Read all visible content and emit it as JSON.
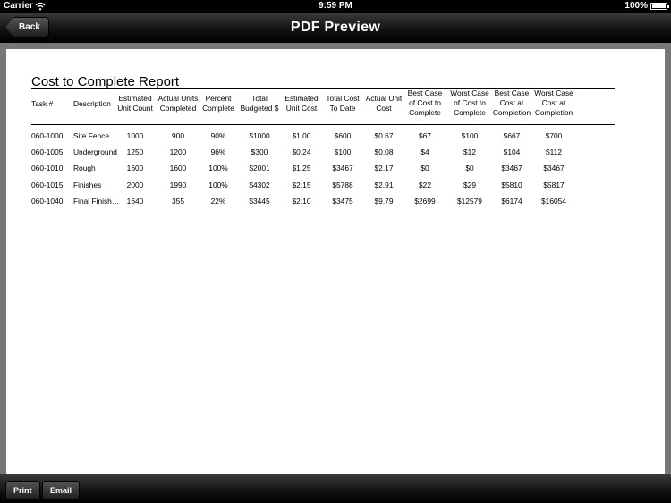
{
  "status": {
    "carrier": "Carrier",
    "time": "9:59 PM",
    "battery": "100%"
  },
  "nav": {
    "back_label": "Back",
    "title": "PDF Preview"
  },
  "report": {
    "title": "Cost to Complete Report",
    "columns": [
      "Task #",
      "Description",
      "Estimated Unit Count",
      "Actual Units Completed",
      "Percent Complete",
      "Total Budgeted $",
      "Estimated Unit Cost",
      "Total Cost To Date",
      "Actual Unit Cost",
      "Best Case of Cost to Complete",
      "Worst Case of Cost to Complete",
      "Best Case Cost at Completion",
      "Worst Case Cost at Completion"
    ],
    "rows": [
      [
        "060-1000",
        "Site Fence",
        "1000",
        "900",
        "90%",
        "$1000",
        "$1.00",
        "$600",
        "$0.67",
        "$67",
        "$100",
        "$667",
        "$700"
      ],
      [
        "060-1005",
        "Underground",
        "1250",
        "1200",
        "96%",
        "$300",
        "$0.24",
        "$100",
        "$0.08",
        "$4",
        "$12",
        "$104",
        "$112"
      ],
      [
        "060-1010",
        "Rough",
        "1600",
        "1600",
        "100%",
        "$2001",
        "$1.25",
        "$3467",
        "$2.17",
        "$0",
        "$0",
        "$3467",
        "$3467"
      ],
      [
        "060-1015",
        "Finishes",
        "2000",
        "1990",
        "100%",
        "$4302",
        "$2.15",
        "$5788",
        "$2.91",
        "$22",
        "$29",
        "$5810",
        "$5817"
      ],
      [
        "060-1040",
        "Final Finish…",
        "1640",
        "355",
        "22%",
        "$3445",
        "$2.10",
        "$3475",
        "$9.79",
        "$2699",
        "$12579",
        "$6174",
        "$16054"
      ]
    ]
  },
  "toolbar": {
    "print_label": "Print",
    "email_label": "Email"
  }
}
